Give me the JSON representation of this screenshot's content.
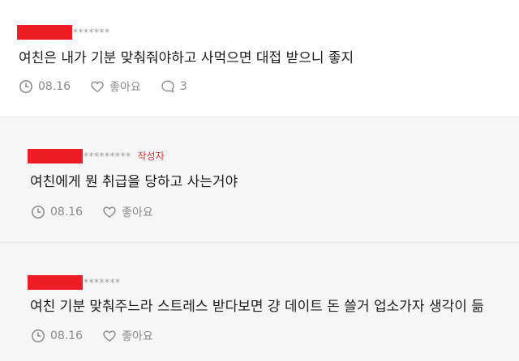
{
  "comments": [
    {
      "author_mask": "*******",
      "text": "여친은 내가 기분 맞춰줘야하고 사먹으면 대접 받으니 좋지",
      "date": "08.16",
      "like_label": "좋아요",
      "reply_count": "3"
    },
    {
      "author_mask": "*********",
      "op_badge": "작성자",
      "text": "여친에게 뭔 취급을 당하고 사는거야",
      "date": "08.16",
      "like_label": "좋아요"
    },
    {
      "author_mask": "*******",
      "text": "여친 기분 맞춰주느라 스트레스 받다보면 걍 데이트 돈 쓸거 업소가자 생각이 듦",
      "date": "08.16",
      "like_label": "좋아요"
    }
  ],
  "icons": {
    "time": "clock-icon",
    "like": "heart-icon",
    "reply": "speech-bubble-icon"
  },
  "colors": {
    "redaction": "#ee1c25",
    "op_badge": "#dd3333",
    "meta": "#8a8a8a",
    "reply_bg": "#f6f6f6"
  }
}
